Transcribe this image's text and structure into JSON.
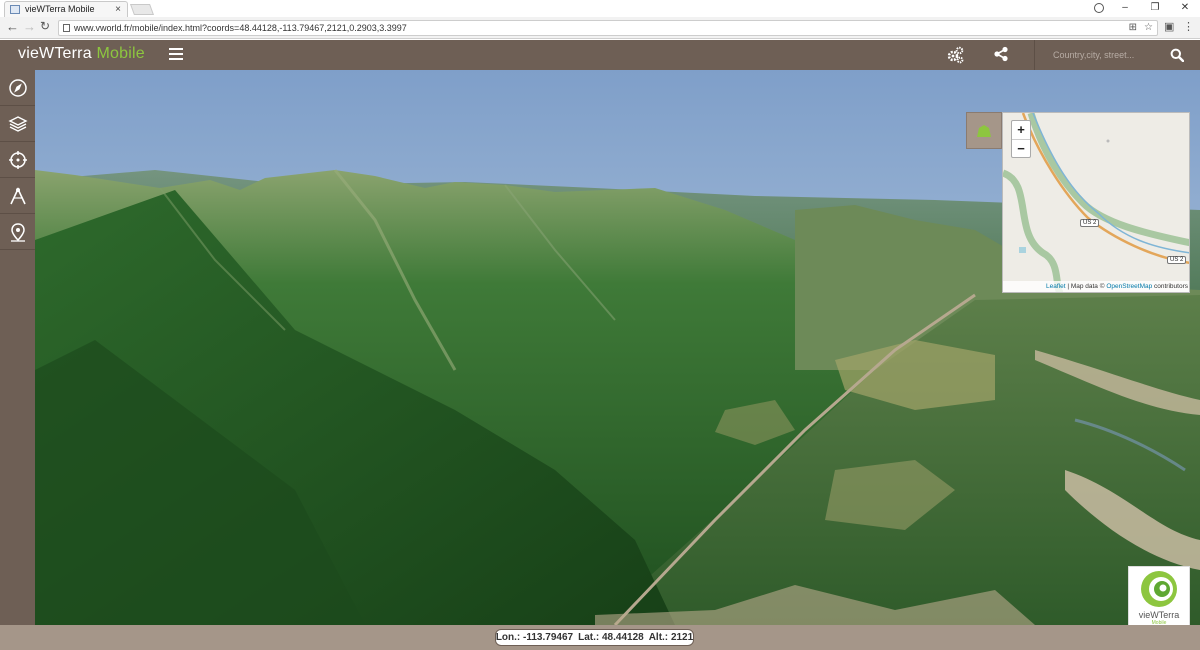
{
  "browser": {
    "tab_title": "vieWTerra Mobile",
    "url": "www.vworld.fr/mobile/index.html?coords=48.44128,-113.79467,2121,0.2903,3.3997"
  },
  "app": {
    "title_main": "vieWTerra",
    "title_accent": "Mobile",
    "accent_color": "#8dc63f",
    "header_color": "#6e5f55",
    "search_placeholder": "Country,city, street..."
  },
  "sidebar": {
    "items": [
      {
        "icon": "compass-icon"
      },
      {
        "icon": "layers-icon"
      },
      {
        "icon": "crosshair-icon"
      },
      {
        "icon": "measure-icon"
      },
      {
        "icon": "location-pin-icon"
      }
    ]
  },
  "minimap": {
    "zoom_in": "+",
    "zoom_out": "−",
    "route_label": "US 2",
    "attribution_leaflet": "Leaflet",
    "attribution_sep": " | Map data © ",
    "attribution_osm": "OpenStreetMap",
    "attribution_tail": " contributors"
  },
  "logo": {
    "text": "vieWTerra",
    "sub": "Mobile"
  },
  "status": {
    "lon_label": "Lon.:",
    "lon": "-113.79467",
    "lat_label": "Lat.:",
    "lat": "48.44128",
    "alt_label": "Alt.:",
    "alt": "2121"
  }
}
